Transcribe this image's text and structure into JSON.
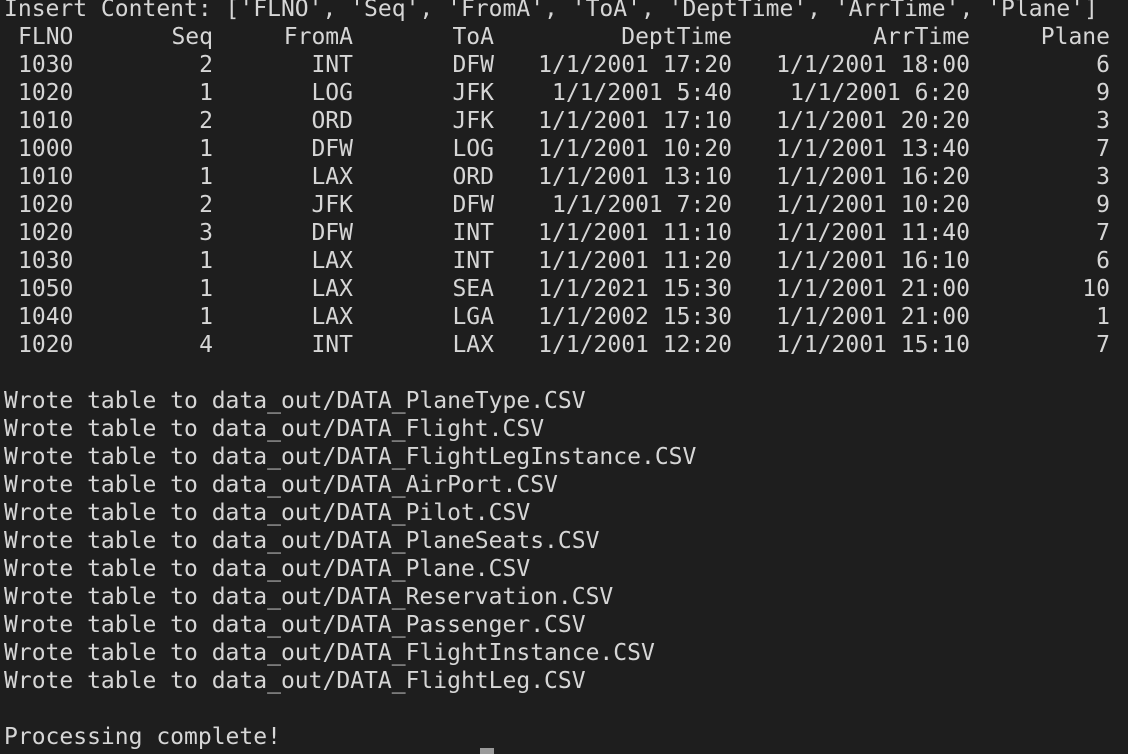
{
  "terminal": {
    "insert_line": "Insert Content: ['FLNO', 'Seq', 'FromA', 'ToA', 'DeptTime', 'ArrTime', 'Plane']",
    "headers": {
      "flno": "FLNO",
      "seq": "Seq",
      "froma": "FromA",
      "toa": "ToA",
      "dept": "DeptTime",
      "arr": "ArrTime",
      "plane": "Plane"
    },
    "rows": [
      {
        "flno": "1030",
        "seq": "2",
        "froma": "INT",
        "toa": "DFW",
        "dept": "1/1/2001 17:20",
        "arr": "1/1/2001 18:00",
        "plane": "6"
      },
      {
        "flno": "1020",
        "seq": "1",
        "froma": "LOG",
        "toa": "JFK",
        "dept": "1/1/2001 5:40",
        "arr": "1/1/2001 6:20",
        "plane": "9"
      },
      {
        "flno": "1010",
        "seq": "2",
        "froma": "ORD",
        "toa": "JFK",
        "dept": "1/1/2001 17:10",
        "arr": "1/1/2001 20:20",
        "plane": "3"
      },
      {
        "flno": "1000",
        "seq": "1",
        "froma": "DFW",
        "toa": "LOG",
        "dept": "1/1/2001 10:20",
        "arr": "1/1/2001 13:40",
        "plane": "7"
      },
      {
        "flno": "1010",
        "seq": "1",
        "froma": "LAX",
        "toa": "ORD",
        "dept": "1/1/2001 13:10",
        "arr": "1/1/2001 16:20",
        "plane": "3"
      },
      {
        "flno": "1020",
        "seq": "2",
        "froma": "JFK",
        "toa": "DFW",
        "dept": "1/1/2001 7:20",
        "arr": "1/1/2001 10:20",
        "plane": "9"
      },
      {
        "flno": "1020",
        "seq": "3",
        "froma": "DFW",
        "toa": "INT",
        "dept": "1/1/2001 11:10",
        "arr": "1/1/2001 11:40",
        "plane": "7"
      },
      {
        "flno": "1030",
        "seq": "1",
        "froma": "LAX",
        "toa": "INT",
        "dept": "1/1/2001 11:20",
        "arr": "1/1/2001 16:10",
        "plane": "6"
      },
      {
        "flno": "1050",
        "seq": "1",
        "froma": "LAX",
        "toa": "SEA",
        "dept": "1/1/2021 15:30",
        "arr": "1/1/2001 21:00",
        "plane": "10"
      },
      {
        "flno": "1040",
        "seq": "1",
        "froma": "LAX",
        "toa": "LGA",
        "dept": "1/1/2002 15:30",
        "arr": "1/1/2001 21:00",
        "plane": "1"
      },
      {
        "flno": "1020",
        "seq": "4",
        "froma": "INT",
        "toa": "LAX",
        "dept": "1/1/2001 12:20",
        "arr": "1/1/2001 15:10",
        "plane": "7"
      }
    ],
    "output_lines": [
      "Wrote table to data_out/DATA_PlaneType.CSV",
      "Wrote table to data_out/DATA_Flight.CSV",
      "Wrote table to data_out/DATA_FlightLegInstance.CSV",
      "Wrote table to data_out/DATA_AirPort.CSV",
      "Wrote table to data_out/DATA_Pilot.CSV",
      "Wrote table to data_out/DATA_PlaneSeats.CSV",
      "Wrote table to data_out/DATA_Plane.CSV",
      "Wrote table to data_out/DATA_Reservation.CSV",
      "Wrote table to data_out/DATA_Passenger.CSV",
      "Wrote table to data_out/DATA_FlightInstance.CSV",
      "Wrote table to data_out/DATA_FlightLeg.CSV"
    ],
    "complete_message": "Processing complete!"
  },
  "colors": {
    "background": "#1e1e1e",
    "text": "#d6d6d6",
    "cursor": "#9a9a9a"
  }
}
